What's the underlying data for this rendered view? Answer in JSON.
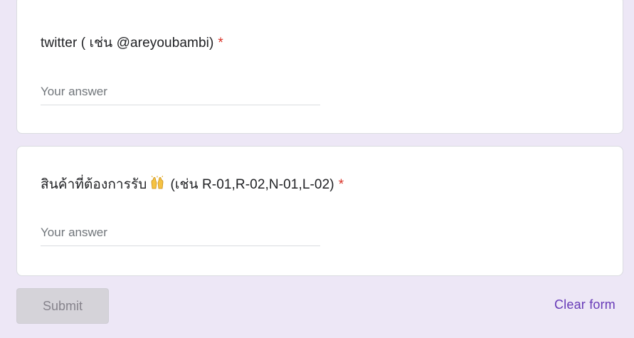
{
  "questions": [
    {
      "title": "twitter ( เช่น @areyoubambi)",
      "required_mark": "*",
      "placeholder": "Your answer",
      "value": ""
    },
    {
      "title_before_emoji": "สินค้าที่ต้องการรับ",
      "emoji_icon": "raising-hands-emoji",
      "title_after_emoji": "(เช่น R-01,R-02,N-01,L-02)",
      "required_mark": "*",
      "placeholder": "Your answer",
      "value": ""
    }
  ],
  "actions": {
    "submit_label": "Submit",
    "clear_label": "Clear form"
  },
  "colors": {
    "page_background": "#ede7f6",
    "required": "#d93025",
    "accent": "#673ab7",
    "submit_disabled_bg": "#d5d3d9"
  }
}
